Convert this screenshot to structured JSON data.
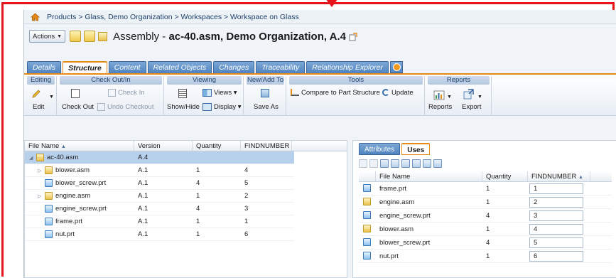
{
  "breadcrumb": {
    "path": "Products > Glass, Demo Organization > Workspaces > Workspace on Glass"
  },
  "titlebar": {
    "actions_label": "Actions",
    "type_label": "Assembly - ",
    "name_label": "ac-40.asm, Demo Organization, A.4"
  },
  "tabs": [
    {
      "label": "Details",
      "active": false
    },
    {
      "label": "Structure",
      "active": true
    },
    {
      "label": "Content",
      "active": false
    },
    {
      "label": "Related Objects",
      "active": false
    },
    {
      "label": "Changes",
      "active": false
    },
    {
      "label": "Traceability",
      "active": false
    },
    {
      "label": "Relationship Explorer",
      "active": false
    }
  ],
  "ribbon": {
    "editing": {
      "title": "Editing",
      "edit": "Edit"
    },
    "checkout": {
      "title": "Check Out/In",
      "check_out": "Check Out",
      "check_in": "Check In",
      "undo_checkout": "Undo Checkout"
    },
    "viewing": {
      "title": "Viewing",
      "show_hide": "Show/Hide",
      "views": "Views",
      "display": "Display"
    },
    "new_add": {
      "title": "New/Add To",
      "save_as": "Save As"
    },
    "tools": {
      "title": "Tools",
      "compare": "Compare to Part Structure",
      "update": "Update"
    },
    "reports": {
      "title": "Reports",
      "reports": "Reports",
      "export": "Export"
    }
  },
  "structure_grid": {
    "columns": [
      "File Name",
      "Version",
      "Quantity",
      "FINDNUMBER"
    ],
    "sort_column": "File Name",
    "root": {
      "name": "ac-40.asm",
      "version": "A.4"
    },
    "rows": [
      {
        "name": "blower.asm",
        "version": "A.1",
        "quantity": "1",
        "find": "4",
        "type": "asm"
      },
      {
        "name": "blower_screw.prt",
        "version": "A.1",
        "quantity": "4",
        "find": "5",
        "type": "prt"
      },
      {
        "name": "engine.asm",
        "version": "A.1",
        "quantity": "1",
        "find": "2",
        "type": "asm"
      },
      {
        "name": "engine_screw.prt",
        "version": "A.1",
        "quantity": "4",
        "find": "3",
        "type": "prt"
      },
      {
        "name": "frame.prt",
        "version": "A.1",
        "quantity": "1",
        "find": "1",
        "type": "prt"
      },
      {
        "name": "nut.prt",
        "version": "A.1",
        "quantity": "1",
        "find": "6",
        "type": "prt"
      }
    ]
  },
  "right_tabs": [
    {
      "label": "Attributes",
      "active": false
    },
    {
      "label": "Uses",
      "active": true
    }
  ],
  "uses_grid": {
    "columns": [
      "File Name",
      "Quantity",
      "FINDNUMBER"
    ],
    "sort_column": "FINDNUMBER",
    "rows": [
      {
        "name": "frame.prt",
        "quantity": "1",
        "find": "1",
        "type": "prt"
      },
      {
        "name": "engine.asm",
        "quantity": "1",
        "find": "2",
        "type": "asm"
      },
      {
        "name": "engine_screw.prt",
        "quantity": "4",
        "find": "3",
        "type": "prt"
      },
      {
        "name": "blower.asm",
        "quantity": "1",
        "find": "4",
        "type": "asm"
      },
      {
        "name": "blower_screw.prt",
        "quantity": "4",
        "find": "5",
        "type": "prt"
      },
      {
        "name": "nut.prt",
        "quantity": "1",
        "find": "6",
        "type": "prt"
      }
    ]
  },
  "colors": {
    "accent_orange": "#e58a18",
    "frame_red": "#e8141b",
    "tab_blue": "#4f83bf",
    "selection": "#b7d1ec"
  }
}
